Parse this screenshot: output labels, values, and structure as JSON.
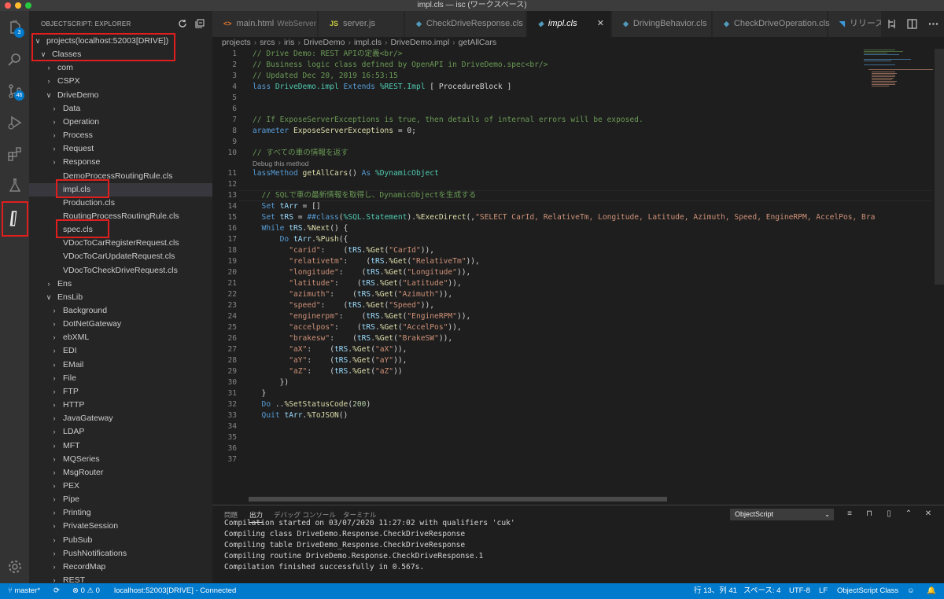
{
  "window": {
    "title": "impl.cls — isc (ワークスペース)"
  },
  "activity": {
    "explorer_badge": "3",
    "scm_badge": "46"
  },
  "sidebar": {
    "title": "OBJECTSCRIPT: EXPLORER",
    "tree": [
      {
        "label": "projects(localhost:52003[DRIVE])",
        "chev": "∨",
        "depth": 0
      },
      {
        "label": "Classes",
        "chev": "∨",
        "depth": 1
      },
      {
        "label": "com",
        "chev": "›",
        "depth": 2
      },
      {
        "label": "CSPX",
        "chev": "›",
        "depth": 2
      },
      {
        "label": "DriveDemo",
        "chev": "∨",
        "depth": 2
      },
      {
        "label": "Data",
        "chev": "›",
        "depth": 3
      },
      {
        "label": "Operation",
        "chev": "›",
        "depth": 3
      },
      {
        "label": "Process",
        "chev": "›",
        "depth": 3
      },
      {
        "label": "Request",
        "chev": "›",
        "depth": 3
      },
      {
        "label": "Response",
        "chev": "›",
        "depth": 3
      },
      {
        "label": "DemoProcessRoutingRule.cls",
        "chev": "",
        "depth": 3
      },
      {
        "label": "impl.cls",
        "chev": "",
        "depth": 3,
        "selected": true
      },
      {
        "label": "Production.cls",
        "chev": "",
        "depth": 3
      },
      {
        "label": "RoutingProcessRoutingRule.cls",
        "chev": "",
        "depth": 3
      },
      {
        "label": "spec.cls",
        "chev": "",
        "depth": 3
      },
      {
        "label": "VDocToCarRegisterRequest.cls",
        "chev": "",
        "depth": 3
      },
      {
        "label": "VDocToCarUpdateRequest.cls",
        "chev": "",
        "depth": 3
      },
      {
        "label": "VDocToCheckDriveRequest.cls",
        "chev": "",
        "depth": 3
      },
      {
        "label": "Ens",
        "chev": "›",
        "depth": 2
      },
      {
        "label": "EnsLib",
        "chev": "∨",
        "depth": 2
      },
      {
        "label": "Background",
        "chev": "›",
        "depth": 3
      },
      {
        "label": "DotNetGateway",
        "chev": "›",
        "depth": 3
      },
      {
        "label": "ebXML",
        "chev": "›",
        "depth": 3
      },
      {
        "label": "EDI",
        "chev": "›",
        "depth": 3
      },
      {
        "label": "EMail",
        "chev": "›",
        "depth": 3
      },
      {
        "label": "File",
        "chev": "›",
        "depth": 3
      },
      {
        "label": "FTP",
        "chev": "›",
        "depth": 3
      },
      {
        "label": "HTTP",
        "chev": "›",
        "depth": 3
      },
      {
        "label": "JavaGateway",
        "chev": "›",
        "depth": 3
      },
      {
        "label": "LDAP",
        "chev": "›",
        "depth": 3
      },
      {
        "label": "MFT",
        "chev": "›",
        "depth": 3
      },
      {
        "label": "MQSeries",
        "chev": "›",
        "depth": 3
      },
      {
        "label": "MsgRouter",
        "chev": "›",
        "depth": 3
      },
      {
        "label": "PEX",
        "chev": "›",
        "depth": 3
      },
      {
        "label": "Pipe",
        "chev": "›",
        "depth": 3
      },
      {
        "label": "Printing",
        "chev": "›",
        "depth": 3
      },
      {
        "label": "PrivateSession",
        "chev": "›",
        "depth": 3
      },
      {
        "label": "PubSub",
        "chev": "›",
        "depth": 3
      },
      {
        "label": "PushNotifications",
        "chev": "›",
        "depth": 3
      },
      {
        "label": "RecordMap",
        "chev": "›",
        "depth": 3
      },
      {
        "label": "REST",
        "chev": "›",
        "depth": 3
      }
    ]
  },
  "tabs": [
    {
      "label": "main.html",
      "desc": "WebServer",
      "icon": "<>",
      "icon_color": "#e37933"
    },
    {
      "label": "server.js",
      "desc": "",
      "icon": "JS",
      "icon_color": "#cbcb41"
    },
    {
      "label": "CheckDriveResponse.cls",
      "desc": "",
      "icon": "◆",
      "icon_color": "#519aba"
    },
    {
      "label": "impl.cls",
      "desc": "",
      "icon": "◆",
      "icon_color": "#519aba",
      "active": true
    },
    {
      "label": "DrivingBehavior.cls",
      "desc": "",
      "icon": "◆",
      "icon_color": "#519aba"
    },
    {
      "label": "CheckDriveOperation.cls",
      "desc": "",
      "icon": "◆",
      "icon_color": "#519aba"
    },
    {
      "label": "リリース",
      "desc": "",
      "icon": "◥",
      "icon_color": "#3c99dc"
    }
  ],
  "breadcrumb": [
    "projects",
    "srcs",
    "iris",
    "DriveDemo",
    "impl.cls",
    "DriveDemo.impl",
    "getAllCars"
  ],
  "editor": {
    "codelens": "Debug this method",
    "lines": [
      {
        "n": "1",
        "parts": [
          [
            "c-com",
            "// Drive Demo: REST APIの定義<br/>"
          ]
        ]
      },
      {
        "n": "2",
        "parts": [
          [
            "c-com",
            "// Business logic class defined by OpenAPI in DriveDemo.spec<br/>"
          ]
        ]
      },
      {
        "n": "3",
        "parts": [
          [
            "c-com",
            "// Updated Dec 20, 2019 16:53:15"
          ]
        ]
      },
      {
        "n": "4",
        "parts": [
          [
            "c-kw",
            "lass "
          ],
          [
            "c-cls",
            "DriveDemo.impl "
          ],
          [
            "c-kw",
            "Extends "
          ],
          [
            "c-cls",
            "%REST.Impl "
          ],
          [
            "c-txt",
            "[ ProcedureBlock ]"
          ]
        ]
      },
      {
        "n": "5",
        "parts": []
      },
      {
        "n": "6",
        "parts": []
      },
      {
        "n": "7",
        "parts": [
          [
            "c-com",
            "// If ExposeServerExceptions is true, then details of internal errors will be exposed."
          ]
        ]
      },
      {
        "n": "8",
        "parts": [
          [
            "c-kw",
            "arameter "
          ],
          [
            "c-fn",
            "ExposeServerExceptions "
          ],
          [
            "c-txt",
            "= 0;"
          ]
        ]
      },
      {
        "n": "9",
        "parts": []
      },
      {
        "n": "10",
        "parts": [
          [
            "c-com",
            "// すべての車の情報を返す"
          ]
        ]
      },
      {
        "n": "11",
        "parts": [
          [
            "c-kw",
            "lassMethod "
          ],
          [
            "c-fn",
            "getAllCars"
          ],
          [
            "c-txt",
            "() "
          ],
          [
            "c-kw",
            "As "
          ],
          [
            "c-cls",
            "%DynamicObject"
          ]
        ]
      },
      {
        "n": "12",
        "parts": []
      },
      {
        "n": "13",
        "parts": [
          [
            "c-com",
            "  // SQLで車の最新情報を取得し、DynamicObjectを生成する"
          ]
        ]
      },
      {
        "n": "14",
        "parts": [
          [
            "c-kw",
            "  Set "
          ],
          [
            "c-var",
            "tArr "
          ],
          [
            "c-txt",
            "= []"
          ]
        ]
      },
      {
        "n": "15",
        "parts": [
          [
            "c-kw",
            "  Set "
          ],
          [
            "c-var",
            "tRS "
          ],
          [
            "c-txt",
            "= "
          ],
          [
            "c-kw",
            "##class"
          ],
          [
            "c-txt",
            "("
          ],
          [
            "c-cls",
            "%SQL.Statement"
          ],
          [
            "c-txt",
            ")."
          ],
          [
            "c-fn",
            "%ExecDirect"
          ],
          [
            "c-txt",
            "(,"
          ],
          [
            "c-str",
            "\"SELECT CarId, RelativeTm, Longitude, Latitude, Azimuth, Speed, EngineRPM, AccelPos, Bra"
          ]
        ]
      },
      {
        "n": "16",
        "parts": [
          [
            "c-kw",
            "  While "
          ],
          [
            "c-var",
            "tRS"
          ],
          [
            "c-txt",
            "."
          ],
          [
            "c-fn",
            "%Next"
          ],
          [
            "c-txt",
            "() {"
          ]
        ]
      },
      {
        "n": "17",
        "parts": [
          [
            "c-kw",
            "      Do "
          ],
          [
            "c-var",
            "tArr"
          ],
          [
            "c-txt",
            "."
          ],
          [
            "c-fn",
            "%Push"
          ],
          [
            "c-txt",
            "({"
          ]
        ]
      },
      {
        "n": "18",
        "parts": [
          [
            "c-str",
            "        \"carid\""
          ],
          [
            "c-txt",
            ":    ("
          ],
          [
            "c-var",
            "tRS"
          ],
          [
            "c-txt",
            "."
          ],
          [
            "c-fn",
            "%Get"
          ],
          [
            "c-txt",
            "("
          ],
          [
            "c-str",
            "\"CarId\""
          ],
          [
            "c-txt",
            ")),"
          ]
        ]
      },
      {
        "n": "19",
        "parts": [
          [
            "c-str",
            "        \"relativetm\""
          ],
          [
            "c-txt",
            ":    ("
          ],
          [
            "c-var",
            "tRS"
          ],
          [
            "c-txt",
            "."
          ],
          [
            "c-fn",
            "%Get"
          ],
          [
            "c-txt",
            "("
          ],
          [
            "c-str",
            "\"RelativeTm\""
          ],
          [
            "c-txt",
            ")),"
          ]
        ]
      },
      {
        "n": "20",
        "parts": [
          [
            "c-str",
            "        \"longitude\""
          ],
          [
            "c-txt",
            ":    ("
          ],
          [
            "c-var",
            "tRS"
          ],
          [
            "c-txt",
            "."
          ],
          [
            "c-fn",
            "%Get"
          ],
          [
            "c-txt",
            "("
          ],
          [
            "c-str",
            "\"Longitude\""
          ],
          [
            "c-txt",
            ")),"
          ]
        ]
      },
      {
        "n": "21",
        "parts": [
          [
            "c-str",
            "        \"latitude\""
          ],
          [
            "c-txt",
            ":    ("
          ],
          [
            "c-var",
            "tRS"
          ],
          [
            "c-txt",
            "."
          ],
          [
            "c-fn",
            "%Get"
          ],
          [
            "c-txt",
            "("
          ],
          [
            "c-str",
            "\"Latitude\""
          ],
          [
            "c-txt",
            ")),"
          ]
        ]
      },
      {
        "n": "22",
        "parts": [
          [
            "c-str",
            "        \"azimuth\""
          ],
          [
            "c-txt",
            ":    ("
          ],
          [
            "c-var",
            "tRS"
          ],
          [
            "c-txt",
            "."
          ],
          [
            "c-fn",
            "%Get"
          ],
          [
            "c-txt",
            "("
          ],
          [
            "c-str",
            "\"Azimuth\""
          ],
          [
            "c-txt",
            ")),"
          ]
        ]
      },
      {
        "n": "23",
        "parts": [
          [
            "c-str",
            "        \"speed\""
          ],
          [
            "c-txt",
            ":    ("
          ],
          [
            "c-var",
            "tRS"
          ],
          [
            "c-txt",
            "."
          ],
          [
            "c-fn",
            "%Get"
          ],
          [
            "c-txt",
            "("
          ],
          [
            "c-str",
            "\"Speed\""
          ],
          [
            "c-txt",
            ")),"
          ]
        ]
      },
      {
        "n": "24",
        "parts": [
          [
            "c-str",
            "        \"enginerpm\""
          ],
          [
            "c-txt",
            ":    ("
          ],
          [
            "c-var",
            "tRS"
          ],
          [
            "c-txt",
            "."
          ],
          [
            "c-fn",
            "%Get"
          ],
          [
            "c-txt",
            "("
          ],
          [
            "c-str",
            "\"EngineRPM\""
          ],
          [
            "c-txt",
            ")),"
          ]
        ]
      },
      {
        "n": "25",
        "parts": [
          [
            "c-str",
            "        \"accelpos\""
          ],
          [
            "c-txt",
            ":    ("
          ],
          [
            "c-var",
            "tRS"
          ],
          [
            "c-txt",
            "."
          ],
          [
            "c-fn",
            "%Get"
          ],
          [
            "c-txt",
            "("
          ],
          [
            "c-str",
            "\"AccelPos\""
          ],
          [
            "c-txt",
            ")),"
          ]
        ]
      },
      {
        "n": "26",
        "parts": [
          [
            "c-str",
            "        \"brakesw\""
          ],
          [
            "c-txt",
            ":    ("
          ],
          [
            "c-var",
            "tRS"
          ],
          [
            "c-txt",
            "."
          ],
          [
            "c-fn",
            "%Get"
          ],
          [
            "c-txt",
            "("
          ],
          [
            "c-str",
            "\"BrakeSW\""
          ],
          [
            "c-txt",
            ")),"
          ]
        ]
      },
      {
        "n": "27",
        "parts": [
          [
            "c-str",
            "        \"aX\""
          ],
          [
            "c-txt",
            ":    ("
          ],
          [
            "c-var",
            "tRS"
          ],
          [
            "c-txt",
            "."
          ],
          [
            "c-fn",
            "%Get"
          ],
          [
            "c-txt",
            "("
          ],
          [
            "c-str",
            "\"aX\""
          ],
          [
            "c-txt",
            ")),"
          ]
        ]
      },
      {
        "n": "28",
        "parts": [
          [
            "c-str",
            "        \"aY\""
          ],
          [
            "c-txt",
            ":    ("
          ],
          [
            "c-var",
            "tRS"
          ],
          [
            "c-txt",
            "."
          ],
          [
            "c-fn",
            "%Get"
          ],
          [
            "c-txt",
            "("
          ],
          [
            "c-str",
            "\"aY\""
          ],
          [
            "c-txt",
            ")),"
          ]
        ]
      },
      {
        "n": "29",
        "parts": [
          [
            "c-str",
            "        \"aZ\""
          ],
          [
            "c-txt",
            ":    ("
          ],
          [
            "c-var",
            "tRS"
          ],
          [
            "c-txt",
            "."
          ],
          [
            "c-fn",
            "%Get"
          ],
          [
            "c-txt",
            "("
          ],
          [
            "c-str",
            "\"aZ\""
          ],
          [
            "c-txt",
            "))"
          ]
        ]
      },
      {
        "n": "30",
        "parts": [
          [
            "c-txt",
            "      })"
          ]
        ]
      },
      {
        "n": "31",
        "parts": [
          [
            "c-txt",
            "  }"
          ]
        ]
      },
      {
        "n": "32",
        "parts": [
          [
            "c-kw",
            "  Do "
          ],
          [
            "c-txt",
            ".."
          ],
          [
            "c-fn",
            "%SetStatusCode"
          ],
          [
            "c-txt",
            "("
          ],
          [
            "c-num",
            "200"
          ],
          [
            "c-txt",
            ")"
          ]
        ]
      },
      {
        "n": "33",
        "parts": [
          [
            "c-kw",
            "  Quit "
          ],
          [
            "c-var",
            "tArr"
          ],
          [
            "c-txt",
            "."
          ],
          [
            "c-fn",
            "%ToJSON"
          ],
          [
            "c-txt",
            "()"
          ]
        ]
      },
      {
        "n": "34",
        "parts": []
      },
      {
        "n": "35",
        "parts": []
      },
      {
        "n": "36",
        "parts": []
      },
      {
        "n": "37",
        "parts": []
      }
    ]
  },
  "panel": {
    "tabs": [
      "問題",
      "出力",
      "デバッグ コンソール",
      "ターミナル"
    ],
    "active_tab": "出力",
    "channel": "ObjectScript",
    "output": [
      "Compilation started on 03/07/2020 11:27:02 with qualifiers 'cuk'",
      "Compiling class DriveDemo.Response.CheckDriveResponse",
      "Compiling table DriveDemo_Response.CheckDriveResponse",
      "Compiling routine DriveDemo.Response.CheckDriveResponse.1",
      "Compilation finished successfully in 0.567s."
    ]
  },
  "status": {
    "branch": "master*",
    "problems": "⊗ 0  ⚠ 0",
    "connection": "localhost:52003[DRIVE] - Connected",
    "position": "行 13、列 41",
    "spaces": "スペース: 4",
    "encoding": "UTF-8",
    "eol": "LF",
    "language": "ObjectScript Class"
  },
  "colors": {
    "accent": "#007acc",
    "highlight_box": "#e01e1e"
  }
}
